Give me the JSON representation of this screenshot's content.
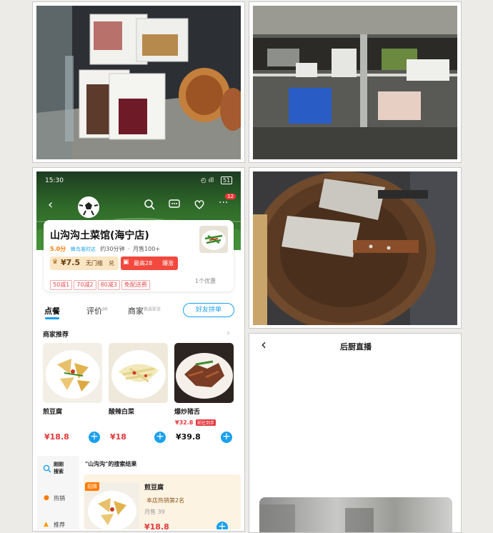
{
  "status": {
    "time": "15:30",
    "battery": "51"
  },
  "shop": {
    "name": "山沟沟土菜馆(海宁店)",
    "rating": "5.0分",
    "delivery_brand": "蜂鸟准时达",
    "delivery_time": "约30分钟",
    "monthly_sales": "月售100+",
    "cart_badge": "12",
    "coupon_value": "¥7.5",
    "coupon_condition": "无门槛",
    "coupon_action": "兑",
    "redpacket_label": "最高28",
    "redpacket_action": "爆涨",
    "promos": [
      "50减1",
      "70减2",
      "80减3",
      "免配送费"
    ],
    "promo_count": "1个优惠"
  },
  "tabs": {
    "order": "点餐",
    "reviews": "评价",
    "reviews_count": "96",
    "merchant": "商家",
    "merchant_sub": "食品安全",
    "group_button": "好友拼单"
  },
  "recommend": {
    "title": "商家推荐",
    "items": [
      {
        "name": "煎豆腐",
        "price": "¥18.8"
      },
      {
        "name": "酸辣白菜",
        "price": "¥18"
      },
      {
        "name": "爆炒猪舌",
        "old_price": "¥32.8",
        "badge": "前往到手",
        "price": "¥39.8"
      }
    ]
  },
  "search": {
    "side_label_1": "刚刚",
    "side_label_2": "搜索",
    "title": "\"山沟沟\"的搜索结果",
    "side_hot": "热销",
    "side_rec": "推荐",
    "item_tag": "招牌",
    "item_name": "煎豆腐",
    "item_rank": "本店热销第2名",
    "item_sales": "月售 39",
    "item_price": "¥18.8"
  },
  "kitchen": {
    "title": "后厨直播"
  },
  "colors": {
    "accent": "#1aa0ee",
    "price": "#e4393c",
    "brand": "#ff6a00"
  }
}
